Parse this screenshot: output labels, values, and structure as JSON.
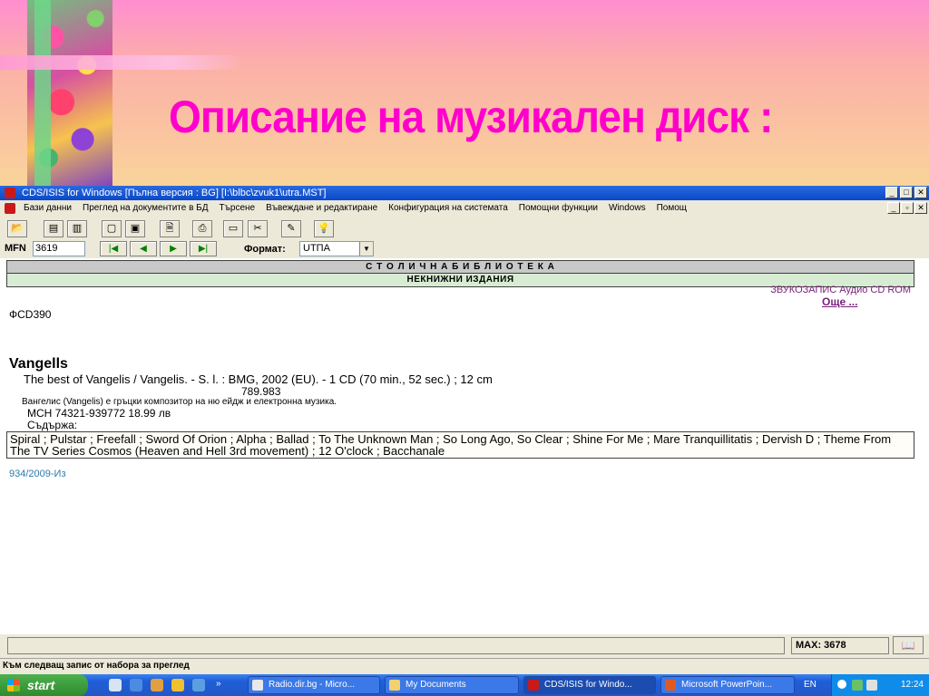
{
  "slide": {
    "title": "Описание на музикален диск :"
  },
  "window": {
    "title": "CDS/ISIS for Windows [Пълна версия : BG]   [I:\\blbc\\zvuk1\\utra.MST]"
  },
  "menu": [
    "Бази данни",
    "Преглед на документите в БД",
    "Търсене",
    "Въвеждане и редактиране",
    "Конфигурация на системата",
    "Помощни функции",
    "Windows",
    "Помощ"
  ],
  "nav": {
    "mfn_label": "MFN",
    "mfn_value": "3619",
    "format_label": "Формат:",
    "format_value": "UTПA"
  },
  "record": {
    "library": "С Т О Л И Ч Н А   Б И Б Л И О Т Е К А",
    "section": "НЕКНИЖНИ  ИЗДАНИЯ",
    "material_type": "ЗВУКОЗАПИС Аудио CD ROM",
    "more_link": "Още ...",
    "shelfmark": "ФCD390",
    "author": "Vangells",
    "description": "The best of Vangelis / Vangelis. - S. l. : BMG, 2002 (EU). - 1 CD (70 min., 52 sec.) ; 12 cm",
    "udc": "789.983",
    "note": "Вангелис (Vangelis) е гръцки композитор на ню ейдж и електронна музика.",
    "price": "MCH 74321-939772   18.99 лв",
    "contents_label": "Съдържа:",
    "contents": "Spiral ; Pulstar ; Freefall ; Sword Of Orion ; Alpha ; Ballad ; To The Unknown Man ; So Long Ago, So Clear ; Shine For Me ; Mare Tranquillitatis ; Dervish D ; Theme From The TV Series Cosmos (Heaven and Hell 3rd movement) ; 12 O'clock ; Bacchanale",
    "inventory": "934/2009-Из"
  },
  "status": {
    "max": "MAX: 3678",
    "hint": "Към следващ запис от набора за преглед"
  },
  "taskbar": {
    "start": "start",
    "tasks": [
      "Radio.dir.bg - Micro...",
      "My Documents",
      "CDS/ISIS for Windo...",
      "Microsoft PowerPoin..."
    ],
    "lang": "EN",
    "clock": "12:24"
  }
}
